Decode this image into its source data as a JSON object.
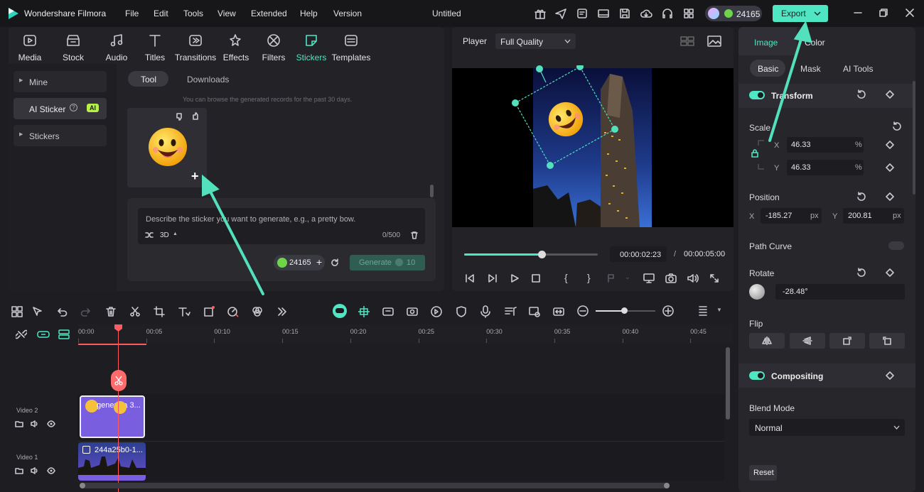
{
  "app": {
    "name": "Wondershare Filmora",
    "project_title": "Untitled"
  },
  "menu": [
    "File",
    "Edit",
    "Tools",
    "View",
    "Extended",
    "Help",
    "Version"
  ],
  "header": {
    "credits": "24165",
    "export_label": "Export"
  },
  "categories": [
    {
      "label": "Media",
      "icon": "media-icon"
    },
    {
      "label": "Stock Media",
      "icon": "stock-media-icon"
    },
    {
      "label": "Audio",
      "icon": "audio-icon"
    },
    {
      "label": "Titles",
      "icon": "titles-icon"
    },
    {
      "label": "Transitions",
      "icon": "transitions-icon"
    },
    {
      "label": "Effects",
      "icon": "effects-icon"
    },
    {
      "label": "Filters",
      "icon": "filters-icon"
    },
    {
      "label": "Stickers",
      "icon": "stickers-icon",
      "active": true
    },
    {
      "label": "Templates",
      "icon": "templates-icon"
    }
  ],
  "sidebar": {
    "items": [
      {
        "label": "Mine"
      },
      {
        "label": "AI Sticker",
        "badge": "AI",
        "active": true
      },
      {
        "label": "Stickers"
      }
    ]
  },
  "sticker_panel": {
    "tabs": [
      "Tool",
      "Downloads"
    ],
    "notice": "You can browse the generated records for the past 30 days.",
    "prompt_placeholder": "Describe the sticker you want to generate, e.g., a pretty bow.",
    "style_label": "3D",
    "char_count": "0/500",
    "credits": "24165",
    "generate_label": "Generate",
    "generate_cost": "10"
  },
  "player": {
    "label": "Player",
    "quality": "Full Quality",
    "current_time": "00:00:02:23",
    "separator": "/",
    "total_time": "00:00:05:00",
    "progress": 0.58
  },
  "properties": {
    "tabs": [
      "Image",
      "Color"
    ],
    "subtabs": [
      "Basic",
      "Mask",
      "AI Tools"
    ],
    "transform_label": "Transform",
    "scale_label": "Scale",
    "scale_x_axis": "X",
    "scale_x": "46.33",
    "scale_y_axis": "Y",
    "scale_y": "46.33",
    "percent_unit": "%",
    "position_label": "Position",
    "pos_x_axis": "X",
    "pos_x": "-185.27",
    "pos_y_axis": "Y",
    "pos_y": "200.81",
    "px_unit": "px",
    "path_curve_label": "Path Curve",
    "rotate_label": "Rotate",
    "rotate_value": "-28.48°",
    "flip_label": "Flip",
    "compositing_label": "Compositing",
    "blend_mode_label": "Blend Mode",
    "blend_mode_value": "Normal",
    "reset_label": "Reset"
  },
  "timeline": {
    "ticks": [
      "00:00",
      "00:05",
      "00:10",
      "00:15",
      "00:20",
      "00:25",
      "00:30",
      "00:35",
      "00:40",
      "00:45"
    ],
    "tracks": [
      {
        "label": "Video 2",
        "clip": "genera a 3..."
      },
      {
        "label": "Video 1",
        "clip": "244a25b0-1..."
      }
    ],
    "add_track": "+"
  },
  "colors": {
    "accent": "#4ee6c3",
    "arrow": "#52e0bd",
    "playhead": "#ff5a5f",
    "sticker_clip": "#7a5ee0"
  }
}
